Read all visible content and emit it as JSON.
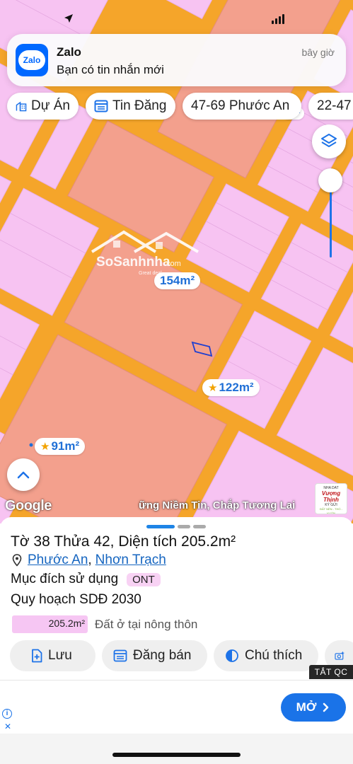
{
  "notification": {
    "app_name": "Zalo",
    "message": "Bạn có tin nhắn mới",
    "time": "bây giờ",
    "icon_text": "Zalo"
  },
  "chips": [
    {
      "label": "Dự Án",
      "icon": "building-icon"
    },
    {
      "label": "Tin Đăng",
      "icon": "listing-icon"
    },
    {
      "label": "47-69 Phước An",
      "icon": ""
    },
    {
      "label": "22-47",
      "icon": ""
    }
  ],
  "map": {
    "area_labels": [
      {
        "text": "154m²",
        "starred": false
      },
      {
        "text": "122m²",
        "starred": true
      },
      {
        "text": "91m²",
        "starred": true
      },
      {
        "text": "m²",
        "starred": false
      }
    ],
    "watermark_text": "SoSanhnha",
    "watermark_suffix": ".com",
    "watermark_tagline": "Great deal",
    "google_logo": "Google",
    "marquee": "ững Niềm Tin, Chắp Tương Lai",
    "ad_logo": {
      "line1": "NHA DAT",
      "line2": "Vượng Thịnh",
      "line3": "KÝ GỬI",
      "line4": "ĐẤT NỀN - THỔ - VƯỜN"
    }
  },
  "parcel": {
    "title": "Tờ 38 Thửa 42, Diện tích 205.2m²",
    "ward": "Phước An",
    "separator": ",",
    "district": "Nhơn Trạch",
    "purpose_label": "Mục đích sử dụng",
    "purpose_code": "ONT",
    "plan_label": "Quy hoạch SDĐ 2030",
    "legend_area": "205.2m²",
    "legend_text": "Đất ở tại nông thôn",
    "legend_color": "#f6c6f3"
  },
  "actions": {
    "save": "Lưu",
    "post": "Đăng bán",
    "notes": "Chú thích"
  },
  "ad": {
    "hide_label": "TẮT QC",
    "open_label": "MỞ",
    "info_glyph": "i",
    "close_glyph": "✕"
  },
  "colors": {
    "road": "#f5a52a",
    "residential": "#f6c6f3",
    "commercial": "#f3a28f",
    "accent": "#1e84e6"
  }
}
